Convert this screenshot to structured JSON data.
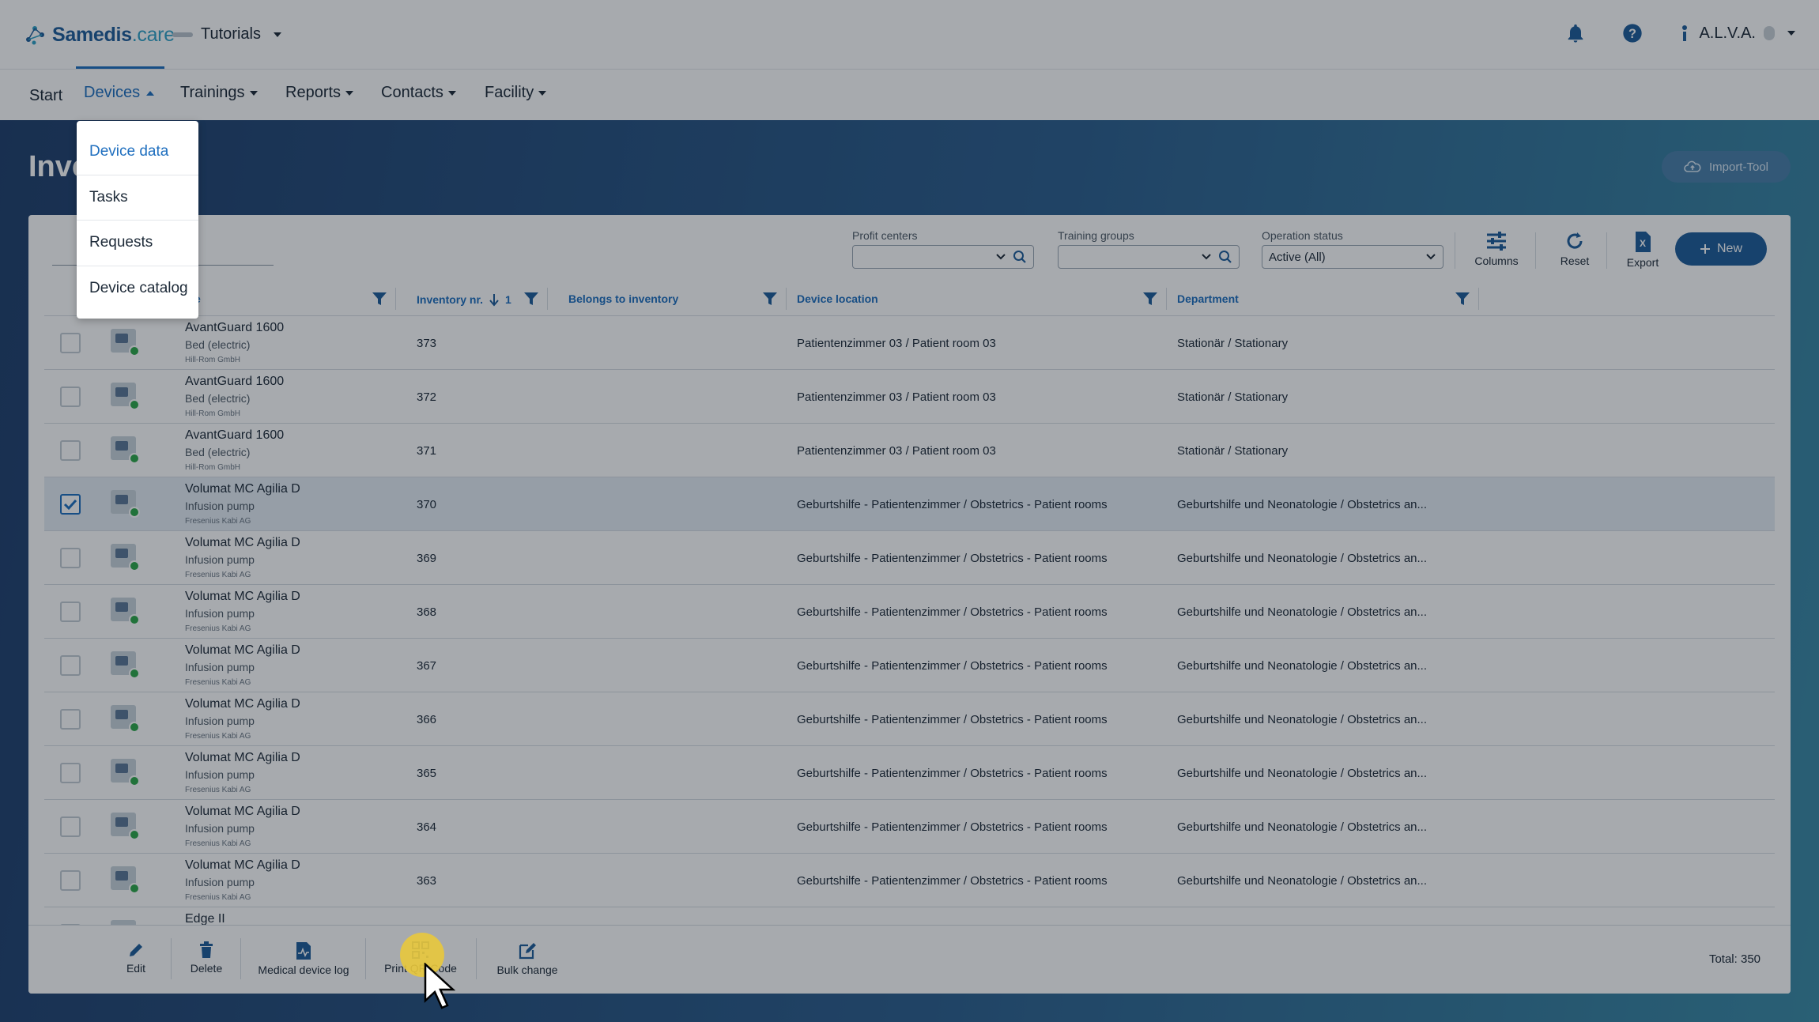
{
  "header": {
    "brand": "Samedis",
    "brand_tld": ".care",
    "tenant": "Tutorials",
    "user_name": "A.L.V.A.",
    "icons": [
      "bell-icon",
      "help-icon",
      "user-icon"
    ]
  },
  "nav": {
    "items": [
      {
        "label": "Start"
      },
      {
        "label": "Devices"
      },
      {
        "label": "Trainings"
      },
      {
        "label": "Reports"
      },
      {
        "label": "Contacts"
      },
      {
        "label": "Facility"
      }
    ],
    "active": "Devices"
  },
  "devices_menu": {
    "items": [
      {
        "label": "Device data"
      },
      {
        "label": "Tasks"
      },
      {
        "label": "Requests"
      },
      {
        "label": "Device catalog"
      }
    ]
  },
  "page": {
    "title": "Inve",
    "import_label": "Import-Tool"
  },
  "toolbar": {
    "search_placeholder": "",
    "profit_centers_label": "Profit centers",
    "training_groups_label": "Training groups",
    "operation_status_label": "Operation status",
    "operation_status_value": "Active (All)",
    "columns_label": "Columns",
    "reset_label": "Reset",
    "export_label": "Export",
    "new_label": "New"
  },
  "table": {
    "columns": {
      "name": "e",
      "inventory": "Inventory nr.",
      "inventory_sort": "1",
      "belongs": "Belongs to inventory",
      "location": "Device location",
      "department": "Department"
    },
    "rows": [
      {
        "name": "AvantGuard 1600",
        "type": "Bed (electric)",
        "manufacturer": "Hill-Rom GmbH",
        "inventory": "373",
        "location": "Patientenzimmer 03 / Patient room 03",
        "department": "Stationär / Stationary",
        "selected": false
      },
      {
        "name": "AvantGuard 1600",
        "type": "Bed (electric)",
        "manufacturer": "Hill-Rom GmbH",
        "inventory": "372",
        "location": "Patientenzimmer 03 / Patient room 03",
        "department": "Stationär / Stationary",
        "selected": false
      },
      {
        "name": "AvantGuard 1600",
        "type": "Bed (electric)",
        "manufacturer": "Hill-Rom GmbH",
        "inventory": "371",
        "location": "Patientenzimmer 03 / Patient room 03",
        "department": "Stationär / Stationary",
        "selected": false
      },
      {
        "name": "Volumat MC Agilia D",
        "type": "Infusion pump",
        "manufacturer": "Fresenius Kabi AG",
        "inventory": "370",
        "location": "Geburtshilfe - Patientenzimmer / Obstetrics - Patient rooms",
        "department": "Geburtshilfe und Neonatologie / Obstetrics an...",
        "selected": true
      },
      {
        "name": "Volumat MC Agilia D",
        "type": "Infusion pump",
        "manufacturer": "Fresenius Kabi AG",
        "inventory": "369",
        "location": "Geburtshilfe - Patientenzimmer / Obstetrics - Patient rooms",
        "department": "Geburtshilfe und Neonatologie / Obstetrics an...",
        "selected": false
      },
      {
        "name": "Volumat MC Agilia D",
        "type": "Infusion pump",
        "manufacturer": "Fresenius Kabi AG",
        "inventory": "368",
        "location": "Geburtshilfe - Patientenzimmer / Obstetrics - Patient rooms",
        "department": "Geburtshilfe und Neonatologie / Obstetrics an...",
        "selected": false
      },
      {
        "name": "Volumat MC Agilia D",
        "type": "Infusion pump",
        "manufacturer": "Fresenius Kabi AG",
        "inventory": "367",
        "location": "Geburtshilfe - Patientenzimmer / Obstetrics - Patient rooms",
        "department": "Geburtshilfe und Neonatologie / Obstetrics an...",
        "selected": false
      },
      {
        "name": "Volumat MC Agilia D",
        "type": "Infusion pump",
        "manufacturer": "Fresenius Kabi AG",
        "inventory": "366",
        "location": "Geburtshilfe - Patientenzimmer / Obstetrics - Patient rooms",
        "department": "Geburtshilfe und Neonatologie / Obstetrics an...",
        "selected": false
      },
      {
        "name": "Volumat MC Agilia D",
        "type": "Infusion pump",
        "manufacturer": "Fresenius Kabi AG",
        "inventory": "365",
        "location": "Geburtshilfe - Patientenzimmer / Obstetrics - Patient rooms",
        "department": "Geburtshilfe und Neonatologie / Obstetrics an...",
        "selected": false
      },
      {
        "name": "Volumat MC Agilia D",
        "type": "Infusion pump",
        "manufacturer": "Fresenius Kabi AG",
        "inventory": "364",
        "location": "Geburtshilfe - Patientenzimmer / Obstetrics - Patient rooms",
        "department": "Geburtshilfe und Neonatologie / Obstetrics an...",
        "selected": false
      },
      {
        "name": "Volumat MC Agilia D",
        "type": "Infusion pump",
        "manufacturer": "Fresenius Kabi AG",
        "inventory": "363",
        "location": "Geburtshilfe - Patientenzimmer / Obstetrics - Patient rooms",
        "department": "Geburtshilfe und Neonatologie / Obstetrics an...",
        "selected": false
      },
      {
        "name": "Edge II",
        "type": "",
        "manufacturer": "",
        "inventory": "",
        "location": "",
        "department": "",
        "selected": false
      }
    ]
  },
  "actions": {
    "edit": "Edit",
    "delete": "Delete",
    "log": "Medical device log",
    "qr": "Print QR-Code",
    "bulk": "Bulk change",
    "total": "Total: 350"
  },
  "colors": {
    "accent": "#1f6fbf",
    "primary": "#1f5d9a",
    "status_ok": "#2ea84a",
    "cursor_highlight": "#e9c83c"
  }
}
